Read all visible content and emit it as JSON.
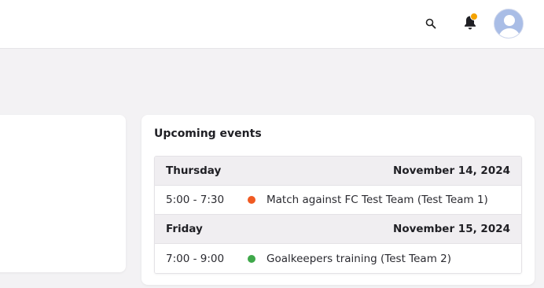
{
  "header": {
    "search_icon": "search-icon",
    "notifications_icon": "bell-icon",
    "notification_dot_color": "#f5a300",
    "avatar_icon": "user-avatar-icon"
  },
  "upcoming": {
    "title": "Upcoming events",
    "days": [
      {
        "day": "Thursday",
        "date": "November 14, 2024",
        "events": [
          {
            "time": "5:00 - 7:30",
            "title": "Match against FC Test Team (Test Team 1)",
            "color": "#f05a22"
          }
        ]
      },
      {
        "day": "Friday",
        "date": "November 15, 2024",
        "events": [
          {
            "time": "7:00 - 9:00",
            "title": "Goalkeepers training (Test Team 2)",
            "color": "#3fa84a"
          }
        ]
      }
    ]
  }
}
